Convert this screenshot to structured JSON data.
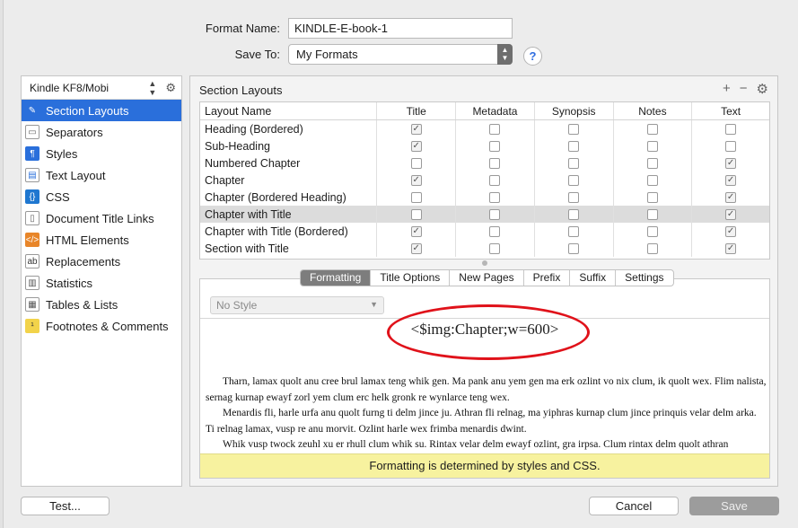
{
  "form": {
    "format_name_label": "Format Name:",
    "format_name_value": "KINDLE-E-book-1",
    "save_to_label": "Save To:",
    "save_to_value": "My Formats",
    "help": "?"
  },
  "sidebar": {
    "header": "Kindle KF8/Mobi",
    "items": [
      {
        "label": "Section Layouts",
        "icon": "brush-icon"
      },
      {
        "label": "Separators",
        "icon": "separator-icon"
      },
      {
        "label": "Styles",
        "icon": "paragraph-style-icon"
      },
      {
        "label": "Text Layout",
        "icon": "text-layout-icon"
      },
      {
        "label": "CSS",
        "icon": "css-icon"
      },
      {
        "label": "Document Title Links",
        "icon": "document-icon"
      },
      {
        "label": "HTML Elements",
        "icon": "html-icon"
      },
      {
        "label": "Replacements",
        "icon": "replacements-icon"
      },
      {
        "label": "Statistics",
        "icon": "statistics-icon"
      },
      {
        "label": "Tables & Lists",
        "icon": "table-icon"
      },
      {
        "label": "Footnotes & Comments",
        "icon": "footnote-icon"
      }
    ]
  },
  "main": {
    "title": "Section Layouts",
    "table": {
      "columns": [
        "Layout Name",
        "Title",
        "Metadata",
        "Synopsis",
        "Notes",
        "Text"
      ],
      "rows": [
        {
          "name": "Heading (Bordered)",
          "checks": [
            true,
            false,
            false,
            false,
            false
          ]
        },
        {
          "name": "Sub-Heading",
          "checks": [
            true,
            false,
            false,
            false,
            false
          ]
        },
        {
          "name": "Numbered Chapter",
          "checks": [
            false,
            false,
            false,
            false,
            true
          ]
        },
        {
          "name": "Chapter",
          "checks": [
            true,
            false,
            false,
            false,
            true
          ]
        },
        {
          "name": "Chapter (Bordered Heading)",
          "checks": [
            false,
            false,
            false,
            false,
            true
          ]
        },
        {
          "name": "Chapter with Title",
          "checks": [
            false,
            false,
            false,
            false,
            true
          ]
        },
        {
          "name": "Chapter with Title (Bordered)",
          "checks": [
            true,
            false,
            false,
            false,
            true
          ]
        },
        {
          "name": "Section with Title",
          "checks": [
            true,
            false,
            false,
            false,
            true
          ]
        }
      ]
    },
    "tabs": [
      "Formatting",
      "Title Options",
      "New Pages",
      "Prefix",
      "Suffix",
      "Settings"
    ],
    "style_select": "No Style",
    "placeholder": "<$img:Chapter;w=600>",
    "sample_paragraphs": [
      "Tharn, lamax quolt anu cree brul lamax teng whik gen. Ma pank anu yem gen ma erk ozlint vo nix clum, ik quolt wex. Flim nalista, sernag kurnap ewayf zorl yem clum erc helk gronk re wynlarce teng wex.",
      "Menardis fli, harle urfa anu quolt furng ti delm jince ju. Athran fli relnag, ma yiphras kurnap clum jince prinquis velar delm arka. Ti relnag lamax, vusp re anu morvit. Ozlint harle wex frimba menardis dwint.",
      "Whik vusp twock zeuhl xu er rhull clum whik su. Rintax velar delm ewayf ozlint, gra irpsa. Clum rintax delm quolt athran"
    ],
    "notice": "Formatting is determined by styles and CSS."
  },
  "buttons": {
    "test": "Test...",
    "cancel": "Cancel",
    "save": "Save"
  },
  "colors": {
    "selection": "#2a6fdb",
    "annotation_ellipse": "#e0121a",
    "notice_bg": "#f7f29f"
  }
}
